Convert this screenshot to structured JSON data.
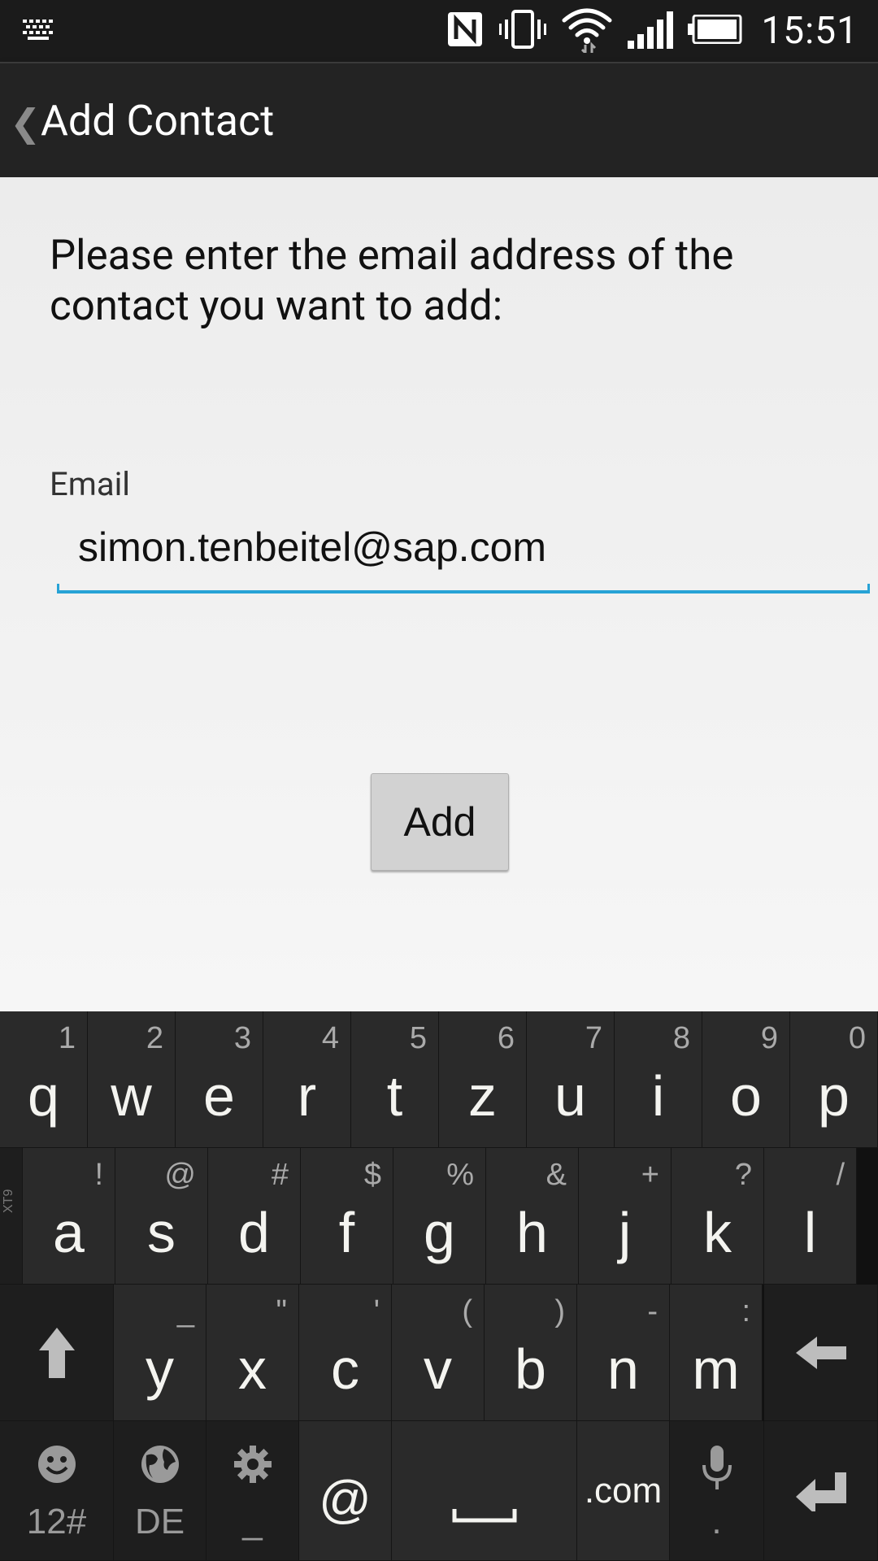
{
  "status_bar": {
    "time": "15:51",
    "icons": [
      "keyboard-icon",
      "nfc-icon",
      "vibrate-icon",
      "wifi-icon",
      "signal-icon",
      "battery-icon"
    ]
  },
  "action_bar": {
    "back_glyph": "❮",
    "title": "Add Contact"
  },
  "content": {
    "prompt": "Please enter the email address of the contact you want to add:",
    "email_label": "Email",
    "email_value": "simon.tenbeitel@sap.com",
    "add_button": "Add",
    "accent_color": "#27a3d6"
  },
  "keyboard": {
    "row1": [
      {
        "key": "q",
        "hint": "1"
      },
      {
        "key": "w",
        "hint": "2"
      },
      {
        "key": "e",
        "hint": "3"
      },
      {
        "key": "r",
        "hint": "4"
      },
      {
        "key": "t",
        "hint": "5"
      },
      {
        "key": "z",
        "hint": "6"
      },
      {
        "key": "u",
        "hint": "7"
      },
      {
        "key": "i",
        "hint": "8"
      },
      {
        "key": "o",
        "hint": "9"
      },
      {
        "key": "p",
        "hint": "0"
      }
    ],
    "row2": [
      {
        "key": "a",
        "hint": "!"
      },
      {
        "key": "s",
        "hint": "@"
      },
      {
        "key": "d",
        "hint": "#"
      },
      {
        "key": "f",
        "hint": "$"
      },
      {
        "key": "g",
        "hint": "%"
      },
      {
        "key": "h",
        "hint": "&"
      },
      {
        "key": "j",
        "hint": "+"
      },
      {
        "key": "k",
        "hint": "?"
      },
      {
        "key": "l",
        "hint": "/"
      }
    ],
    "row2_side_tag": "XT9",
    "row3": [
      {
        "key": "y",
        "hint": "_"
      },
      {
        "key": "x",
        "hint": "\""
      },
      {
        "key": "c",
        "hint": "'"
      },
      {
        "key": "v",
        "hint": "("
      },
      {
        "key": "b",
        "hint": ")"
      },
      {
        "key": "n",
        "hint": "-"
      },
      {
        "key": "m",
        "hint": ":"
      }
    ],
    "row4": {
      "symbols_label": "12#",
      "language_label": "DE",
      "settings_sub": "_",
      "at_key": "@",
      "dotcom_key": ".com",
      "mic_sub": "."
    }
  }
}
